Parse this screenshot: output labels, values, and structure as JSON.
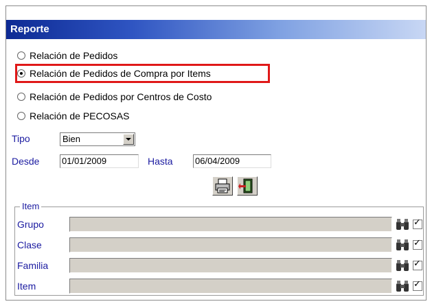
{
  "window": {
    "title": "Reporte"
  },
  "report_options": [
    {
      "label": "Relación de Pedidos",
      "checked": false
    },
    {
      "label": "Relación de Pedidos de Compra por Items",
      "checked": true
    },
    {
      "label": "Relación de Pedidos por Centros de Costo",
      "checked": false
    },
    {
      "label": "Relación de PECOSAS",
      "checked": false
    }
  ],
  "tipo": {
    "label": "Tipo",
    "value": "Bien"
  },
  "desde": {
    "label": "Desde",
    "value": "01/01/2009"
  },
  "hasta": {
    "label": "Hasta",
    "value": "06/04/2009"
  },
  "toolbar": {
    "print_icon": "printer-icon",
    "exit_icon": "exit-door-icon"
  },
  "item_group": {
    "legend": "Item",
    "fields": [
      {
        "label": "Grupo",
        "value": "",
        "checked": true
      },
      {
        "label": "Clase",
        "value": "",
        "checked": true
      },
      {
        "label": "Familia",
        "value": "",
        "checked": true
      },
      {
        "label": "Item",
        "value": "",
        "checked": true
      }
    ]
  },
  "colors": {
    "title_start": "#0d2a94",
    "title_end": "#c8d7f4",
    "label_blue": "#1a1aa0",
    "highlight": "#e01818"
  }
}
